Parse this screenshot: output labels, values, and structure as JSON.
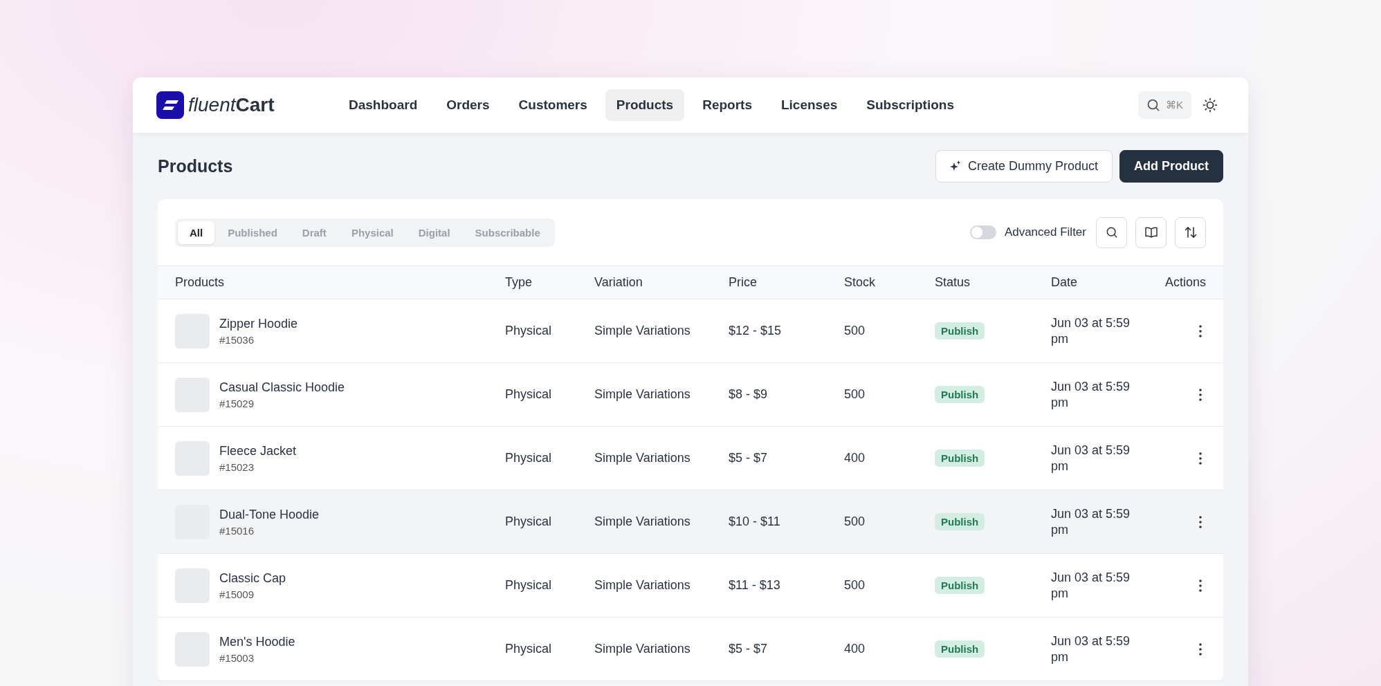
{
  "brand": {
    "name_light": "fluent",
    "name_bold": "Cart"
  },
  "nav": [
    {
      "label": "Dashboard",
      "selected": false
    },
    {
      "label": "Orders",
      "selected": false
    },
    {
      "label": "Customers",
      "selected": false
    },
    {
      "label": "Products",
      "selected": true
    },
    {
      "label": "Reports",
      "selected": false
    },
    {
      "label": "Licenses",
      "selected": false
    },
    {
      "label": "Subscriptions",
      "selected": false
    }
  ],
  "search_shortcut": "⌘K",
  "page_title": "Products",
  "actions": {
    "secondary": "Create Dummy Product",
    "primary": "Add Product"
  },
  "filter_tabs": [
    {
      "label": "All",
      "selected": true
    },
    {
      "label": "Published",
      "selected": false
    },
    {
      "label": "Draft",
      "selected": false
    },
    {
      "label": "Physical",
      "selected": false
    },
    {
      "label": "Digital",
      "selected": false
    },
    {
      "label": "Subscribable",
      "selected": false
    }
  ],
  "advanced_filter": {
    "label": "Advanced Filter",
    "on": false
  },
  "table": {
    "columns": [
      "Products",
      "Type",
      "Variation",
      "Price",
      "Stock",
      "Status",
      "Date",
      "Actions"
    ],
    "rows": [
      {
        "name": "Zipper Hoodie",
        "id": "#15036",
        "type": "Physical",
        "variation": "Simple Variations",
        "price": "$12 - $15",
        "stock": "500",
        "status": "Publish",
        "date": "Jun 03 at 5:59 pm",
        "hovered": false
      },
      {
        "name": "Casual Classic Hoodie",
        "id": "#15029",
        "type": "Physical",
        "variation": "Simple Variations",
        "price": "$8 - $9",
        "stock": "500",
        "status": "Publish",
        "date": "Jun 03 at 5:59 pm",
        "hovered": false
      },
      {
        "name": "Fleece Jacket",
        "id": "#15023",
        "type": "Physical",
        "variation": "Simple Variations",
        "price": "$5 - $7",
        "stock": "400",
        "status": "Publish",
        "date": "Jun 03 at 5:59 pm",
        "hovered": false
      },
      {
        "name": "Dual-Tone Hoodie",
        "id": "#15016",
        "type": "Physical",
        "variation": "Simple Variations",
        "price": "$10 - $11",
        "stock": "500",
        "status": "Publish",
        "date": "Jun 03 at 5:59 pm",
        "hovered": true
      },
      {
        "name": "Classic Cap",
        "id": "#15009",
        "type": "Physical",
        "variation": "Simple Variations",
        "price": "$11 - $13",
        "stock": "500",
        "status": "Publish",
        "date": "Jun 03 at 5:59 pm",
        "hovered": false
      },
      {
        "name": "Men's Hoodie",
        "id": "#15003",
        "type": "Physical",
        "variation": "Simple Variations",
        "price": "$5 - $7",
        "stock": "400",
        "status": "Publish",
        "date": "Jun 03 at 5:59 pm",
        "hovered": false
      }
    ]
  }
}
